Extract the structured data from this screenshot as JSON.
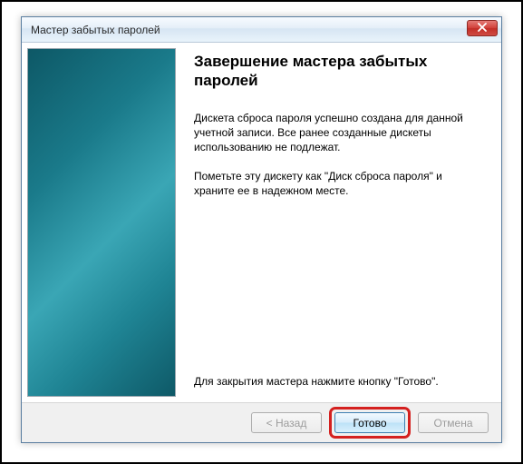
{
  "window": {
    "title": "Мастер забытых паролей"
  },
  "main": {
    "heading": "Завершение мастера забытых паролей",
    "paragraph1": "Дискета сброса пароля успешно создана для данной учетной записи. Все ранее созданные дискеты использованию не подлежат.",
    "paragraph2": "Пометьте эту дискету как \"Диск сброса пароля\" и храните ее в надежном месте.",
    "footer_text": "Для закрытия мастера нажмите кнопку \"Готово\"."
  },
  "buttons": {
    "back": "< Назад",
    "finish": "Готово",
    "cancel": "Отмена"
  }
}
